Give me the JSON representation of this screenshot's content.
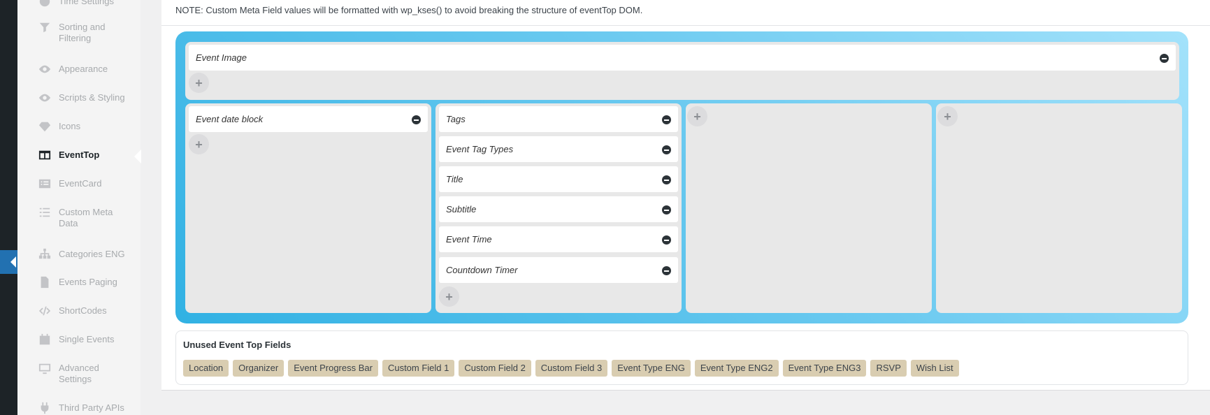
{
  "nav": {
    "items": [
      {
        "label": "Time Settings",
        "icon": "clock-icon"
      },
      {
        "label": "Sorting and\nFiltering",
        "icon": "filter-icon"
      },
      {
        "label": "Appearance",
        "icon": "eye-icon"
      },
      {
        "label": "Scripts & Styling",
        "icon": "eye-icon"
      },
      {
        "label": "Icons",
        "icon": "gem-icon"
      },
      {
        "label": "EventTop",
        "icon": "columns-icon"
      },
      {
        "label": "EventCard",
        "icon": "list-card-icon"
      },
      {
        "label": "Custom Meta\nData",
        "icon": "list-icon"
      },
      {
        "label": "Categories ENG",
        "icon": "sitemap-icon"
      },
      {
        "label": "Events Paging",
        "icon": "file-icon"
      },
      {
        "label": "ShortCodes",
        "icon": "code-icon"
      },
      {
        "label": "Single Events",
        "icon": "calendar-icon"
      },
      {
        "label": "Advanced\nSettings",
        "icon": "settings-icon"
      },
      {
        "label": "Third Party APIs",
        "icon": "plug-icon"
      }
    ]
  },
  "note": "NOTE: Custom Meta Field values will be formatted with wp_kses() to avoid breaking the structure of eventTop DOM.",
  "layout": {
    "top_row": [
      "Event Image"
    ],
    "columns": [
      [
        "Event date block"
      ],
      [
        "Tags",
        "Event Tag Types",
        "Title",
        "Subtitle",
        "Event Time",
        "Countdown Timer"
      ],
      [],
      []
    ],
    "add_symbol": "+"
  },
  "unused": {
    "title": "Unused Event Top Fields",
    "fields": [
      "Location",
      "Organizer",
      "Event Progress Bar",
      "Custom Field 1",
      "Custom Field 2",
      "Custom Field 3",
      "Event Type ENG",
      "Event Type ENG2",
      "Event Type ENG3",
      "RSVP",
      "Wish List"
    ]
  },
  "colors": {
    "accent": "#2271b1",
    "board_gradient_start": "#31b1e3",
    "tag_bg": "#d9cdb1"
  }
}
